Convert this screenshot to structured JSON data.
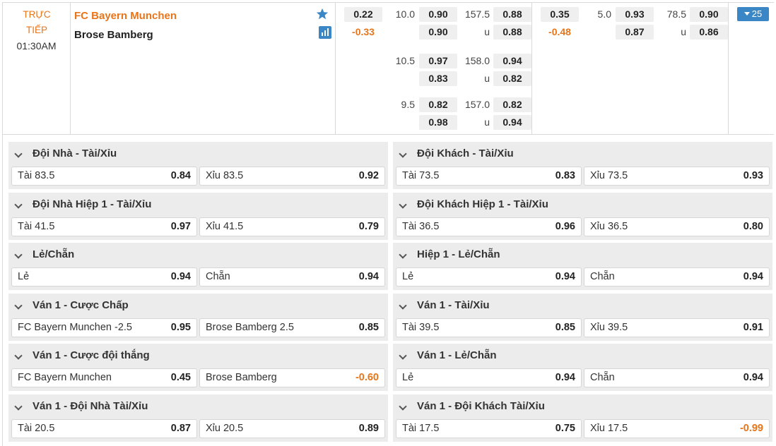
{
  "match": {
    "status": "TRỰC TIẾP",
    "time": "01:30AM",
    "home_team": "FC Bayern Munchen",
    "away_team": "Brose Bamberg",
    "icons": {
      "favorite": "star-icon",
      "stats": "bar-chart-icon"
    },
    "colors": {
      "accent": "#e8751a",
      "blue": "#3b86c5"
    },
    "full_time": {
      "moneyline": [
        "0.22",
        "-0.33"
      ],
      "handicap_rows": [
        {
          "line": "10.0",
          "home": "0.90",
          "away": "0.90",
          "total": "157.5",
          "over": "0.88",
          "under_label": "u",
          "under": "0.88"
        },
        {
          "line": "10.5",
          "home": "0.97",
          "away": "0.83",
          "total": "158.0",
          "over": "0.94",
          "under_label": "u",
          "under": "0.82"
        },
        {
          "line": "9.5",
          "home": "0.82",
          "away": "0.98",
          "total": "157.0",
          "over": "0.82",
          "under_label": "u",
          "under": "0.94"
        }
      ]
    },
    "first_half": {
      "moneyline": [
        "0.35",
        "-0.48"
      ],
      "handicap_rows": [
        {
          "line": "5.0",
          "home": "0.93",
          "away": "0.87",
          "total": "78.5",
          "over": "0.90",
          "under_label": "u",
          "under": "0.86"
        }
      ]
    },
    "more_markets": "25"
  },
  "markets": {
    "left": [
      {
        "title": "Đội Nhà - Tài/Xỉu",
        "a_label": "Tài 83.5",
        "a_val": "0.84",
        "b_label": "Xỉu 83.5",
        "b_val": "0.92"
      },
      {
        "title": "Đội Nhà Hiệp 1 - Tài/Xỉu",
        "a_label": "Tài 41.5",
        "a_val": "0.97",
        "b_label": "Xỉu 41.5",
        "b_val": "0.79"
      },
      {
        "title": "Lẻ/Chẵn",
        "a_label": "Lẻ",
        "a_val": "0.94",
        "b_label": "Chẵn",
        "b_val": "0.94"
      },
      {
        "title": "Ván 1 - Cược Chấp",
        "a_label": "FC Bayern Munchen  -2.5",
        "a_val": "0.95",
        "b_label": "Brose Bamberg  2.5",
        "b_val": "0.85"
      },
      {
        "title": "Ván 1 - Cược đội thắng",
        "a_label": "FC Bayern Munchen",
        "a_val": "0.45",
        "b_label": "Brose Bamberg",
        "b_val": "-0.60"
      },
      {
        "title": "Ván 1 - Đội Nhà Tài/Xỉu",
        "a_label": "Tài 20.5",
        "a_val": "0.87",
        "b_label": "Xỉu 20.5",
        "b_val": "0.89"
      }
    ],
    "right": [
      {
        "title": "Đội Khách - Tài/Xỉu",
        "a_label": "Tài 73.5",
        "a_val": "0.83",
        "b_label": "Xỉu 73.5",
        "b_val": "0.93"
      },
      {
        "title": "Đội Khách Hiệp 1 - Tài/Xỉu",
        "a_label": "Tài 36.5",
        "a_val": "0.96",
        "b_label": "Xỉu 36.5",
        "b_val": "0.80"
      },
      {
        "title": "Hiệp 1 - Lẻ/Chẵn",
        "a_label": "Lẻ",
        "a_val": "0.94",
        "b_label": "Chẵn",
        "b_val": "0.94"
      },
      {
        "title": "Ván 1 - Tài/Xỉu",
        "a_label": "Tài 39.5",
        "a_val": "0.85",
        "b_label": "Xỉu 39.5",
        "b_val": "0.91"
      },
      {
        "title": "Ván 1 - Lẻ/Chẵn",
        "a_label": "Lẻ",
        "a_val": "0.94",
        "b_label": "Chẵn",
        "b_val": "0.94"
      },
      {
        "title": "Ván 1 - Đội Khách Tài/Xỉu",
        "a_label": "Tài 17.5",
        "a_val": "0.75",
        "b_label": "Xỉu 17.5",
        "b_val": "-0.99"
      }
    ]
  }
}
